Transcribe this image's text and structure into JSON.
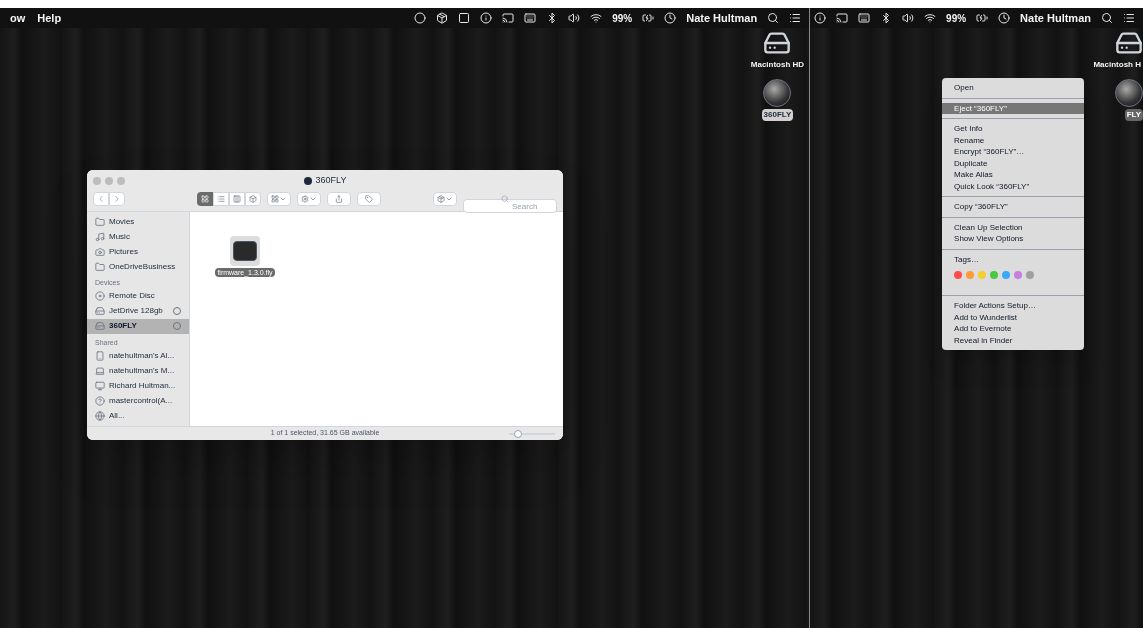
{
  "left_screen": {
    "menu_bar": {
      "menus": [
        "ow",
        "Help"
      ],
      "battery": "99%",
      "user": "Nate Hultman"
    },
    "desktop_icons": [
      {
        "kind": "disk",
        "label": "Macintosh HD"
      },
      {
        "kind": "camera",
        "label": "360FLY"
      }
    ],
    "finder_window": {
      "title": "360FLY",
      "search": {
        "placeholder": "Search"
      },
      "sidebar": [
        {
          "items": [
            {
              "kind": "folder",
              "label": "Movies",
              "selected": false
            },
            {
              "kind": "music",
              "label": "Music",
              "selected": false
            },
            {
              "kind": "camera",
              "label": "Pictures",
              "selected": false
            },
            {
              "kind": "folder",
              "label": "OneDriveBusiness",
              "selected": false
            }
          ]
        },
        {
          "header": "Devices",
          "items": [
            {
              "kind": "disc",
              "label": "Remote Disc",
              "selected": false
            },
            {
              "kind": "drive",
              "label": "JetDrive 128gb",
              "eject": true,
              "selected": false
            },
            {
              "kind": "drive",
              "label": "360FLY",
              "eject": true,
              "selected": true
            }
          ]
        },
        {
          "header": "Shared",
          "items": [
            {
              "kind": "phone",
              "label": "natehultman's Al...",
              "selected": false
            },
            {
              "kind": "laptop",
              "label": "natehultman's M...",
              "selected": false
            },
            {
              "kind": "monitor",
              "label": "Richard Hultman...",
              "selected": false
            },
            {
              "kind": "unknown",
              "label": "mastercontrol(A...",
              "selected": false
            },
            {
              "kind": "globe",
              "label": "All...",
              "selected": false
            }
          ]
        }
      ],
      "files": [
        {
          "name": "firmware_1.3.0.fly",
          "selected": true
        }
      ],
      "status": "1 of 1 selected, 31.65 GB available",
      "zoom": {
        "level": 0.2
      }
    }
  },
  "right_screen": {
    "menu_bar": {
      "battery": "99%",
      "user": "Nate Hultman"
    },
    "desktop_icons": [
      {
        "kind": "disk",
        "label": "Macintosh H"
      },
      {
        "kind": "camera",
        "label": "FLY"
      }
    ],
    "context_menu": [
      [
        {
          "label": "Open",
          "selected": false
        }
      ],
      [
        {
          "label": "Eject “360FLY”",
          "selected": true
        }
      ],
      [
        {
          "label": "Get Info",
          "selected": false
        },
        {
          "label": "Rename",
          "selected": false
        },
        {
          "label": "Encrypt “360FLY”…",
          "selected": false
        },
        {
          "label": "Duplicate",
          "selected": false
        },
        {
          "label": "Make Alias",
          "selected": false
        },
        {
          "label": "Quick Look “360FLY”",
          "selected": false
        }
      ],
      [
        {
          "label": "Copy “360FLY”",
          "selected": false
        }
      ],
      [
        {
          "label": "Clean Up Selection",
          "selected": false
        },
        {
          "label": "Show View Options",
          "selected": false
        }
      ],
      [
        {
          "label": "Tags…",
          "selected": false
        }
      ],
      [
        {
          "label": "Folder Actions Setup…",
          "selected": false
        },
        {
          "label": "Add to Wunderlist",
          "selected": false
        },
        {
          "label": "Add to Evernote",
          "selected": false
        },
        {
          "label": "Reveal in Finder",
          "selected": false
        }
      ]
    ],
    "tag_colors": [
      {
        "color": "#fe4b4b"
      },
      {
        "color": "#ff9c33"
      },
      {
        "color": "#f5cf2a"
      },
      {
        "color": "#4cc742"
      },
      {
        "color": "#3ba9f5"
      },
      {
        "color": "#c77de0"
      },
      {
        "color": "#a0a0a0"
      }
    ]
  }
}
